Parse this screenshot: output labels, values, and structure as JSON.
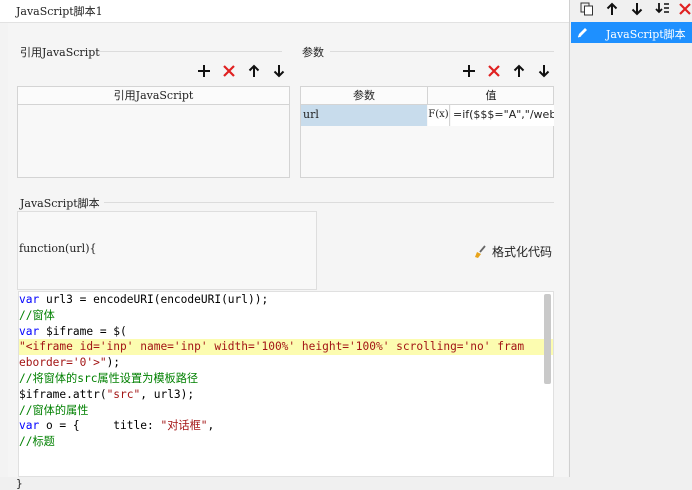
{
  "window": {
    "title": "JavaScript脚本1"
  },
  "references": {
    "section_title": "引用JavaScript",
    "column_header": "引用JavaScript"
  },
  "params": {
    "section_title": "参数",
    "columns": [
      "参数",
      "值"
    ],
    "rows": [
      {
        "name": "url",
        "fx": "F(x)",
        "value": "=if($$$=\"A\",\"/webi"
      }
    ]
  },
  "script": {
    "section_title": "JavaScript脚本",
    "function_header": "function(url){",
    "format_label": "格式化代码",
    "closing": "}"
  },
  "code_lines": [
    [
      {
        "t": "var",
        "c": "kw"
      },
      {
        "t": " url3 = encodeURI(encodeURI(url));",
        "c": "pl"
      }
    ],
    [
      {
        "t": "//窗体",
        "c": "cm"
      }
    ],
    [
      {
        "t": "var",
        "c": "kw"
      },
      {
        "t": " $iframe = $(",
        "c": "pl"
      }
    ],
    [
      {
        "t": "\"<iframe id='inp' name='inp' width='100%' height='100%' scrolling='no' fram",
        "c": "st",
        "hl": true
      }
    ],
    [
      {
        "t": "eborder='0'>\"",
        "c": "st"
      },
      {
        "t": ");",
        "c": "pl"
      }
    ],
    [
      {
        "t": "//将窗体的src属性设置为模板路径",
        "c": "cm"
      }
    ],
    [
      {
        "t": "$iframe.attr(",
        "c": "pl"
      },
      {
        "t": "\"src\"",
        "c": "st"
      },
      {
        "t": ", url3);",
        "c": "pl"
      }
    ],
    [
      {
        "t": "//窗体的属性",
        "c": "cm"
      }
    ],
    [
      {
        "t": "var",
        "c": "kw"
      },
      {
        "t": " o = {     title: ",
        "c": "pl"
      },
      {
        "t": "\"对话框\"",
        "c": "st"
      },
      {
        "t": ",",
        "c": "pl"
      }
    ],
    [
      {
        "t": "//标题",
        "c": "cm"
      }
    ]
  ],
  "right_panel": {
    "selected_item": "JavaScript脚本"
  },
  "colors": {
    "accent": "#1e90ff",
    "delete": "#e02020",
    "highlight": "#fcfcb0"
  }
}
